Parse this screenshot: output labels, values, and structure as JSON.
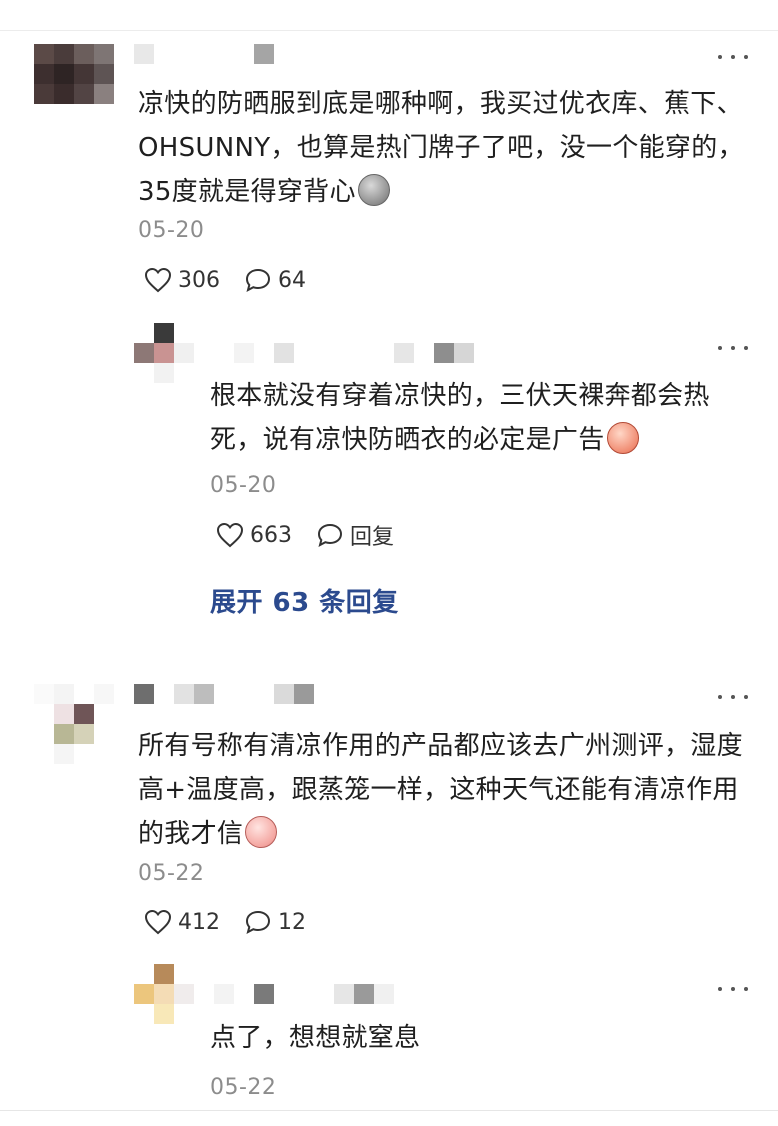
{
  "comments": [
    {
      "text": "凉快的防晒服到底是哪种啊，我买过优衣库、蕉下、OHSUNNY，也算是热门牌子了吧，没一个能穿的，35度就是得穿背心",
      "emoji": "grey-face-emoji",
      "date": "05-20",
      "likes": "306",
      "replies": "64",
      "reply": {
        "text": "根本就没有穿着凉快的，三伏天裸奔都会热死，说有凉快防晒衣的必定是广告",
        "emoji": "crying-face-emoji",
        "date": "05-20",
        "likes": "663",
        "reply_label": "回复"
      },
      "expand_label": "展开 63 条回复"
    },
    {
      "text": "所有号称有清凉作用的产品都应该去广州测评，湿度高+温度高，跟蒸笼一样，这种天气还能有清凉作用的我才信",
      "emoji": "sweating-face-emoji",
      "date": "05-22",
      "likes": "412",
      "replies": "12",
      "reply": {
        "text": "点了，想想就窒息",
        "date": "05-22"
      }
    }
  ],
  "colors": {
    "link": "#2b4a8e",
    "meta": "#8c8c8c"
  }
}
